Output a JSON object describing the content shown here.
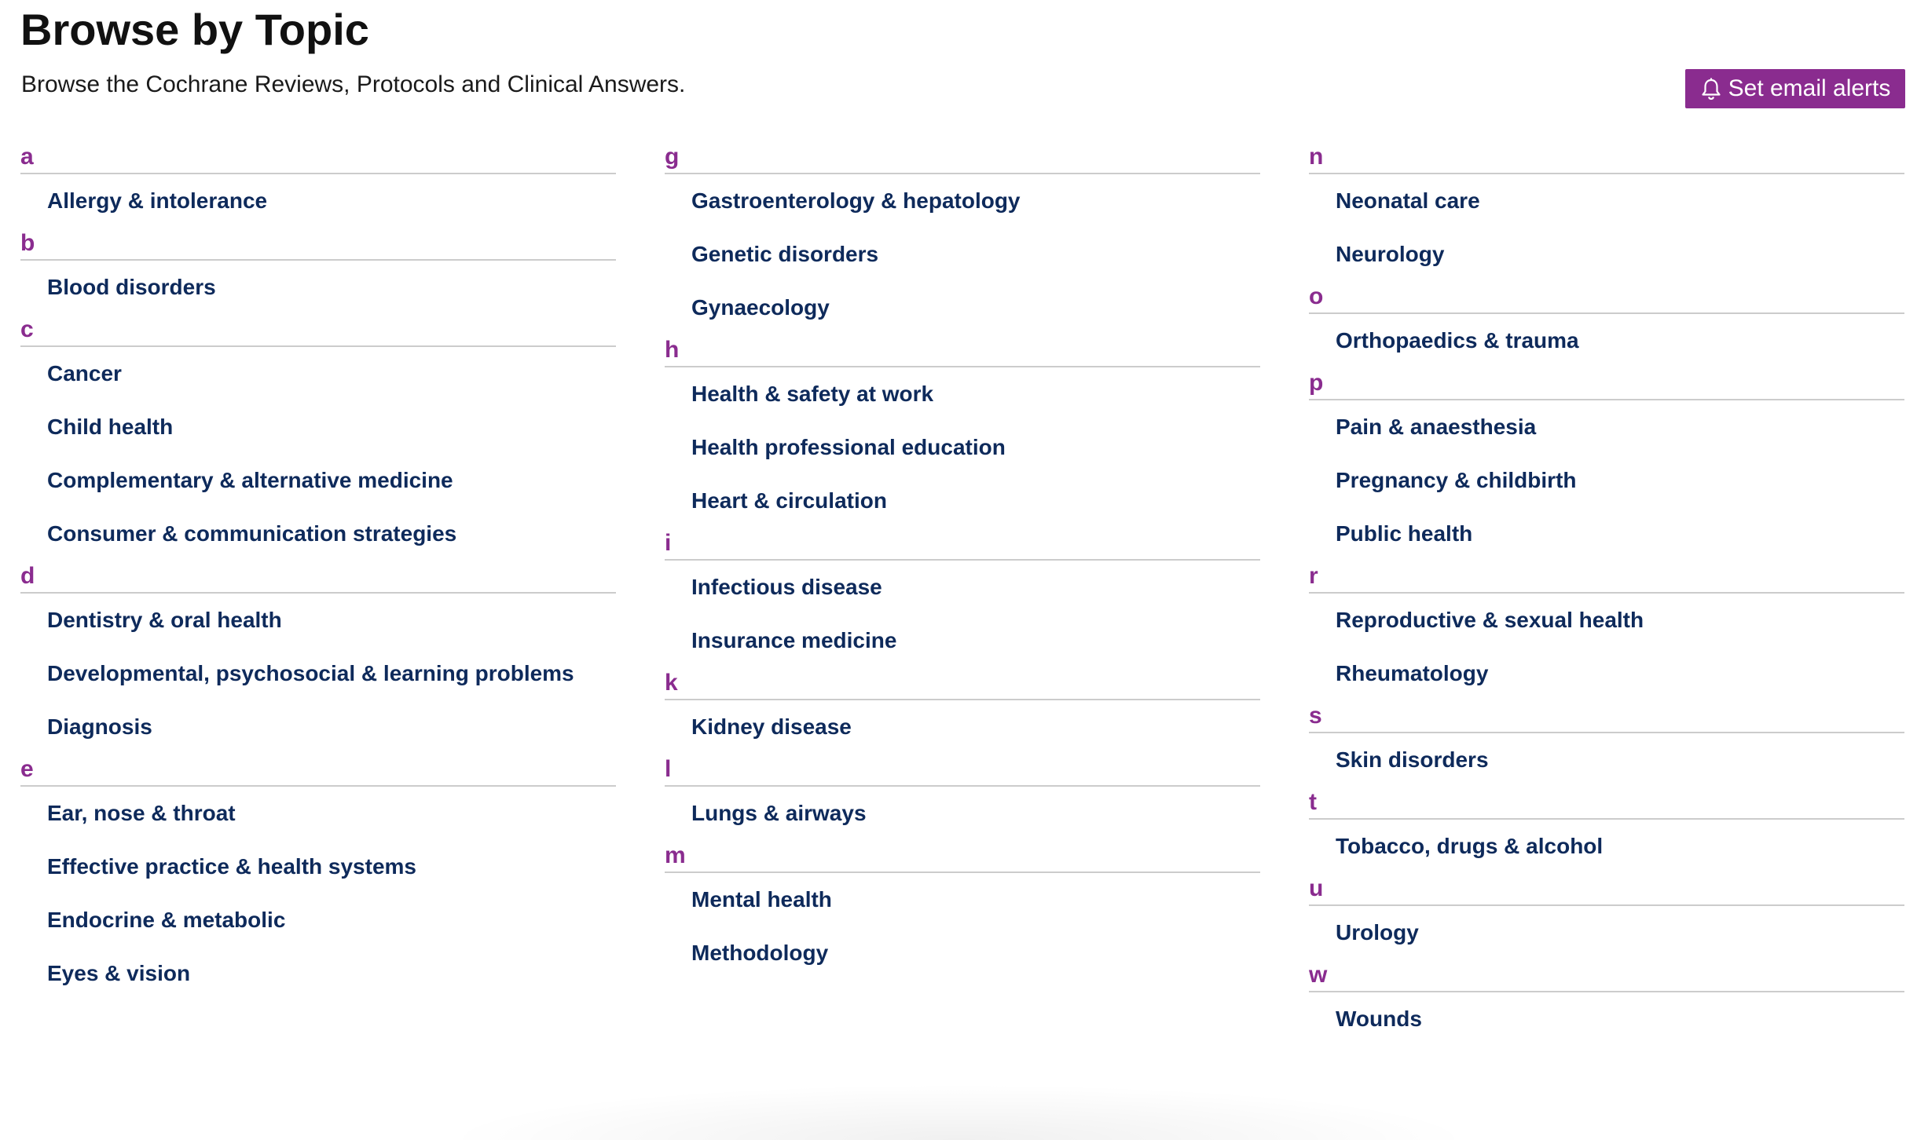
{
  "page": {
    "title": "Browse by Topic",
    "subtitle": "Browse the Cochrane Reviews, Protocols and Clinical Answers.",
    "alert_button_label": "Set email alerts",
    "alert_icon": "bell-icon"
  },
  "colors": {
    "accent": "#8a2c8f",
    "link": "#0e2a5b",
    "divider": "#cccccc"
  },
  "columns": [
    [
      {
        "letter": "a",
        "topics": [
          "Allergy & intolerance"
        ]
      },
      {
        "letter": "b",
        "topics": [
          "Blood disorders"
        ]
      },
      {
        "letter": "c",
        "topics": [
          "Cancer",
          "Child health",
          "Complementary & alternative medicine",
          "Consumer & communication strategies"
        ]
      },
      {
        "letter": "d",
        "topics": [
          "Dentistry & oral health",
          "Developmental, psychosocial & learning problems",
          "Diagnosis"
        ]
      },
      {
        "letter": "e",
        "topics": [
          "Ear, nose & throat",
          "Effective practice & health systems",
          "Endocrine & metabolic",
          "Eyes & vision"
        ]
      }
    ],
    [
      {
        "letter": "g",
        "topics": [
          "Gastroenterology & hepatology",
          "Genetic disorders",
          "Gynaecology"
        ]
      },
      {
        "letter": "h",
        "topics": [
          "Health & safety at work",
          "Health professional education",
          "Heart & circulation"
        ]
      },
      {
        "letter": "i",
        "topics": [
          "Infectious disease",
          "Insurance medicine"
        ]
      },
      {
        "letter": "k",
        "topics": [
          "Kidney disease"
        ]
      },
      {
        "letter": "l",
        "topics": [
          "Lungs & airways"
        ]
      },
      {
        "letter": "m",
        "topics": [
          "Mental health",
          "Methodology"
        ]
      }
    ],
    [
      {
        "letter": "n",
        "topics": [
          "Neonatal care",
          "Neurology"
        ]
      },
      {
        "letter": "o",
        "topics": [
          "Orthopaedics & trauma"
        ]
      },
      {
        "letter": "p",
        "topics": [
          "Pain & anaesthesia",
          "Pregnancy & childbirth",
          "Public health"
        ]
      },
      {
        "letter": "r",
        "topics": [
          "Reproductive & sexual health",
          "Rheumatology"
        ]
      },
      {
        "letter": "s",
        "topics": [
          "Skin disorders"
        ]
      },
      {
        "letter": "t",
        "topics": [
          "Tobacco, drugs & alcohol"
        ]
      },
      {
        "letter": "u",
        "topics": [
          "Urology"
        ]
      },
      {
        "letter": "w",
        "topics": [
          "Wounds"
        ]
      }
    ]
  ]
}
